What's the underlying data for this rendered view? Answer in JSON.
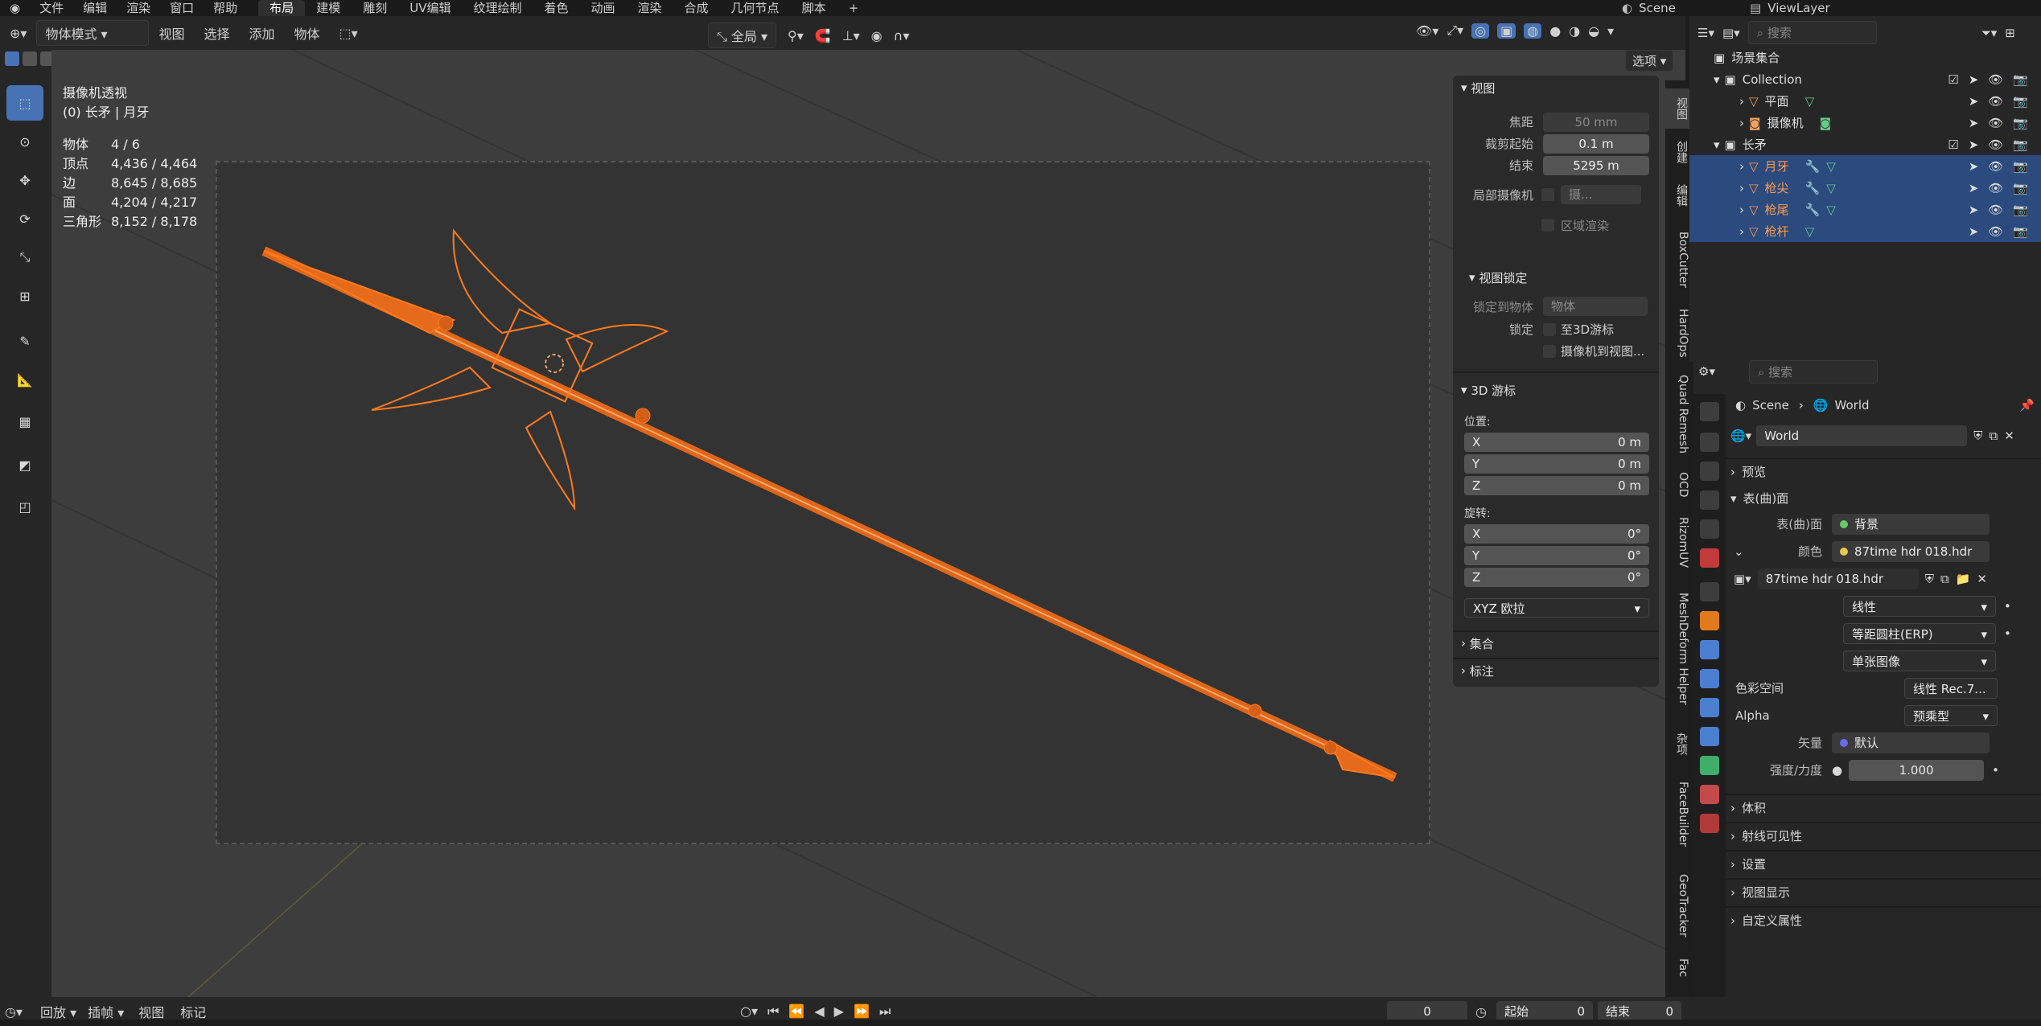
{
  "menu": {
    "items": [
      "文件",
      "编辑",
      "渲染",
      "窗口",
      "帮助"
    ]
  },
  "workspaces": [
    "布局",
    "建模",
    "雕刻",
    "UV编辑",
    "纹理绘制",
    "着色",
    "动画",
    "渲染",
    "合成",
    "几何节点",
    "脚本"
  ],
  "workspace_add": "+",
  "scene_name": "Scene",
  "view_layer": "ViewLayer",
  "header": {
    "mode": "物体模式",
    "items": [
      "视图",
      "选择",
      "添加",
      "物体"
    ],
    "transform": "全局",
    "options": "选项"
  },
  "viewport": {
    "title": "摄像机透视",
    "subtitle": "(0) 长矛 | 月牙",
    "stats": [
      {
        "k": "物体",
        "v": "4 / 6"
      },
      {
        "k": "顶点",
        "v": "4,436 / 4,464"
      },
      {
        "k": "边",
        "v": "8,645 / 8,685"
      },
      {
        "k": "面",
        "v": "4,204 / 4,217"
      },
      {
        "k": "三角形",
        "v": "8,152 / 8,178"
      }
    ]
  },
  "npanel": {
    "view_header": "视图",
    "focal_label": "焦距",
    "focal": "50 mm",
    "clip_start_label": "裁剪起始",
    "clip_start": "0.1 m",
    "clip_end_label": "结束",
    "clip_end": "5295 m",
    "local_cam_label": "局部摄像机",
    "local_cam": "摄...",
    "region_render": "区域渲染",
    "view_lock_header": "视图锁定",
    "lock_obj_label": "锁定到物体",
    "lock_obj": "物体",
    "lock_label": "锁定",
    "to_cursor": "至3D游标",
    "cam_to_view": "摄像机到视图...",
    "cursor_header": "3D 游标",
    "location_label": "位置:",
    "rotation_label": "旋转:",
    "loc": [
      {
        "axis": "X",
        "val": "0 m"
      },
      {
        "axis": "Y",
        "val": "0 m"
      },
      {
        "axis": "Z",
        "val": "0 m"
      }
    ],
    "rot": [
      {
        "axis": "X",
        "val": "0°"
      },
      {
        "axis": "Y",
        "val": "0°"
      },
      {
        "axis": "Z",
        "val": "0°"
      }
    ],
    "rot_mode": "XYZ 欧拉",
    "collection_header": "集合",
    "annotation_header": "标注"
  },
  "side_tabs": [
    "视图",
    "创建",
    "编辑",
    "BoxCutter",
    "HardOps",
    "Quad Remesh",
    "OCD",
    "RizomUV",
    "MeshDeform Helper",
    "杂项",
    "FaceBuilder",
    "GeoTracker",
    "Fac"
  ],
  "outliner": {
    "search_placeholder": "搜索",
    "rows": [
      {
        "label": "场景集合",
        "indent": 0
      },
      {
        "label": "Collection",
        "indent": 1
      },
      {
        "label": "平面",
        "indent": 2
      },
      {
        "label": "摄像机",
        "indent": 2
      },
      {
        "label": "长矛",
        "indent": 1
      },
      {
        "label": "月牙",
        "indent": 2
      },
      {
        "label": "枪尖",
        "indent": 2
      },
      {
        "label": "枪尾",
        "indent": 2
      },
      {
        "label": "枪杆",
        "indent": 2
      }
    ]
  },
  "properties": {
    "search_placeholder": "搜索",
    "breadcrumb_scene": "Scene",
    "breadcrumb_world": "World",
    "world_name": "World",
    "preview": "预览",
    "surface_header": "表(曲)面",
    "surface_label": "表(曲)面",
    "surface_val": "背景",
    "color_label": "颜色",
    "color_val": "87time hdr 018.hdr",
    "image_name": "87time hdr 018.hdr",
    "interp": "线性",
    "projection": "等距圆柱(ERP)",
    "source": "单张图像",
    "colorspace_label": "色彩空间",
    "colorspace": "线性 Rec.7...",
    "alpha_label": "Alpha",
    "alpha": "预乘型",
    "vector_label": "矢量",
    "vector": "默认",
    "strength_label": "强度/力度",
    "strength": "1.000",
    "sections": [
      "体积",
      "射线可见性",
      "设置",
      "视图显示",
      "自定义属性"
    ]
  },
  "timeline": {
    "playback": "回放",
    "keying": "插帧",
    "view": "视图",
    "marker": "标记",
    "frame": "0",
    "start_label": "起始",
    "start": "0",
    "end_label": "结束",
    "end": "0"
  },
  "colors": {
    "accent": "#4772b3",
    "selection": "#ff7a1a",
    "orange": "#e0661a"
  }
}
